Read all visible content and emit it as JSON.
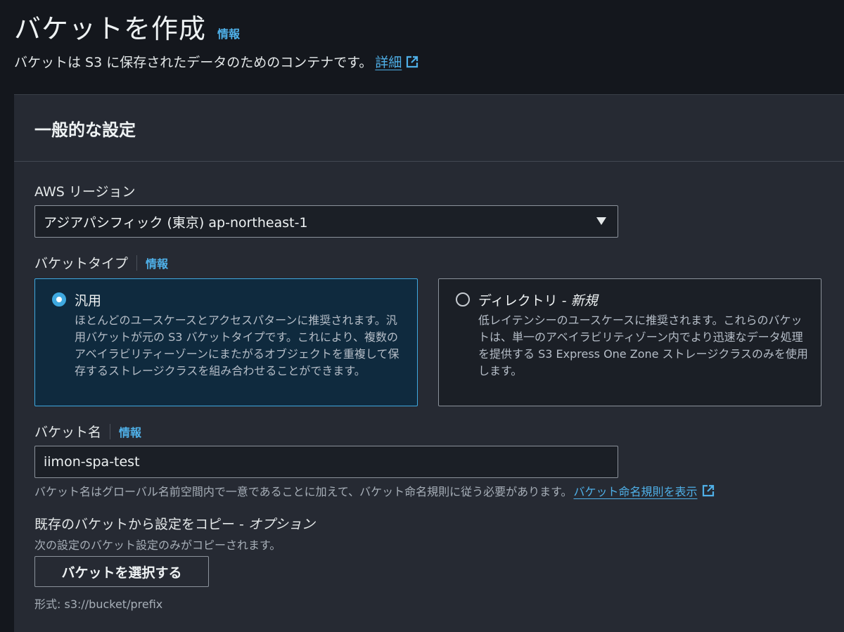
{
  "header": {
    "title": "バケットを作成",
    "info_link": "情報",
    "description": "バケットは S3 に保存されたデータのためのコンテナです。",
    "details_link": "詳細"
  },
  "general": {
    "section_title": "一般的な設定",
    "region_label": "AWS リージョン",
    "region_value": "アジアパシフィック (東京) ap-northeast-1",
    "bucket_type_label": "バケットタイプ",
    "bucket_type_info": "情報",
    "options": [
      {
        "title": "汎用",
        "title_suffix": "",
        "selected": true,
        "description": "ほとんどのユースケースとアクセスパターンに推奨されます。汎用バケットが元の S3 バケットタイプです。これにより、複数のアベイラビリティーゾーンにまたがるオブジェクトを重複して保存するストレージクラスを組み合わせることができます。"
      },
      {
        "title": "ディレクトリ - ",
        "title_suffix": "新規",
        "selected": false,
        "description": "低レイテンシーのユースケースに推奨されます。これらのバケットは、単一のアベイラビリティゾーン内でより迅速なデータ処理を提供する S3 Express One Zone ストレージクラスのみを使用します。"
      }
    ],
    "bucket_name_label": "バケット名",
    "bucket_name_info": "情報",
    "bucket_name_value": "iimon-spa-test",
    "bucket_name_hint": "バケット名はグローバル名前空間内で一意であることに加えて、バケット命名規則に従う必要があります。",
    "naming_rules_link": "バケット命名規則を表示",
    "copy_label": "既存のバケットから設定をコピー - ",
    "copy_label_optional": "オプション",
    "copy_hint": "次の設定のバケット設定のみがコピーされます。",
    "select_bucket_button": "バケットを選択する",
    "format_hint": "形式: s3://bucket/prefix"
  },
  "icons": {
    "external_link": "external-link-icon",
    "caret": "caret-down-icon"
  },
  "colors": {
    "accent": "#3fa9e0",
    "link": "#4fb0e8",
    "background": "#14171d",
    "panel": "#262a33"
  }
}
